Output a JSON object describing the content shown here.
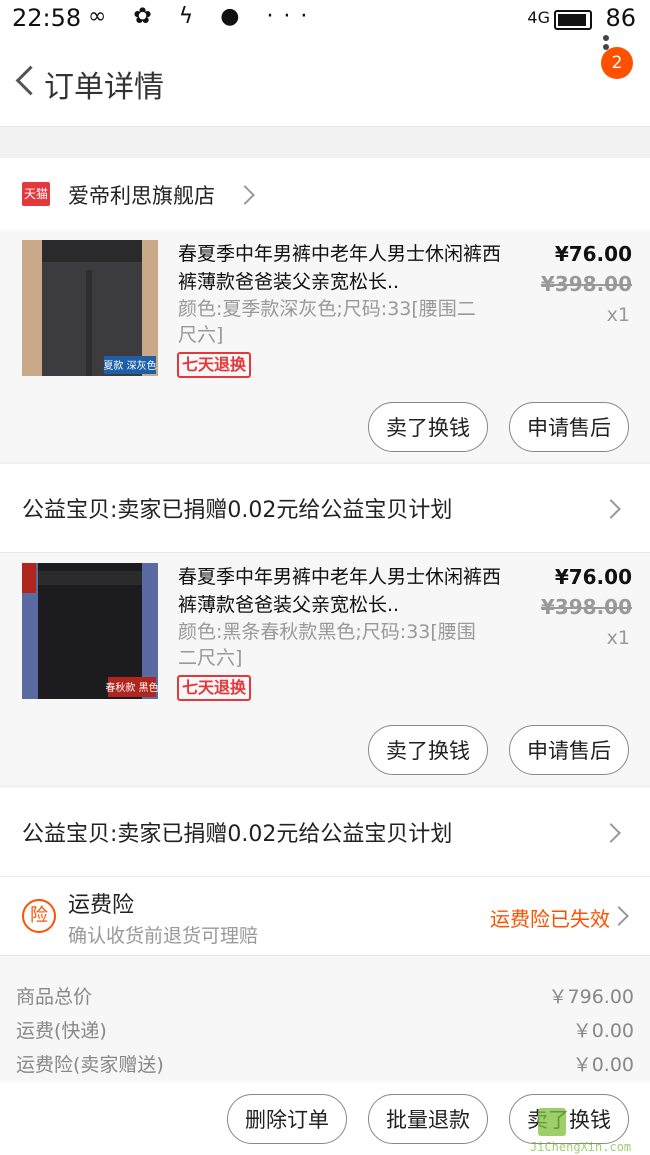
{
  "status_bar": {
    "time": "22:58",
    "icons": "∞ ✿ ϟ ● ···",
    "network": "4G",
    "battery": "86"
  },
  "nav": {
    "title": "订单详情",
    "badge": "2"
  },
  "shop": {
    "name": "爱帝利思旗舰店",
    "badge_text": "天猫"
  },
  "items": [
    {
      "title": "春夏季中年男裤中老年人男士休闲裤西裤薄款爸爸装父亲宽松长..",
      "attrs": "颜色:夏季款深灰色;尺码:33[腰围二尺六]",
      "tag": "七天退换",
      "price": "¥76.00",
      "original_price": "¥398.00",
      "qty": "x1",
      "thumb_label": "夏款 深灰色",
      "btn_sell": "卖了换钱",
      "btn_after_sale": "申请售后"
    },
    {
      "title": "春夏季中年男裤中老年人男士休闲裤西裤薄款爸爸装父亲宽松长..",
      "attrs": "颜色:黑条春秋款黑色;尺码:33[腰围二尺六]",
      "tag": "七天退换",
      "price": "¥76.00",
      "original_price": "¥398.00",
      "qty": "x1",
      "thumb_label": "春秋款 黑色",
      "btn_sell": "卖了换钱",
      "btn_after_sale": "申请售后"
    }
  ],
  "charity": {
    "label": "公益宝贝:卖家已捐赠0.02元给公益宝贝计划"
  },
  "insurance": {
    "icon": "险",
    "title": "运费险",
    "subtitle": "确认收货前退货可理赔",
    "status": "运费险已失效"
  },
  "summary": [
    {
      "label": "商品总价",
      "value": "￥796.00"
    },
    {
      "label": "运费(快递)",
      "value": "￥0.00"
    },
    {
      "label": "运费险(卖家赠送)",
      "value": "￥0.00"
    }
  ],
  "actions": {
    "delete": "删除订单",
    "batch_refund": "批量退款",
    "sell": "卖了换钱"
  },
  "watermark": {
    "text": "JiChengXin.com"
  }
}
